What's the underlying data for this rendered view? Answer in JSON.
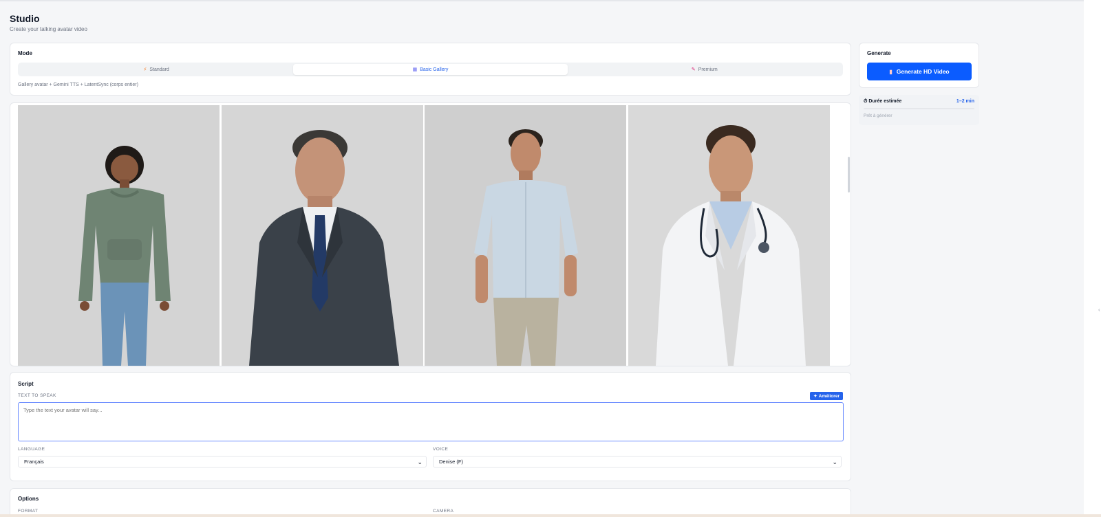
{
  "page": {
    "title": "Studio",
    "subtitle": "Create your talking avatar video"
  },
  "mode": {
    "title": "Mode",
    "options": [
      {
        "label": "Standard",
        "icon": "bolt-icon",
        "active": false
      },
      {
        "label": "Basic Gallery",
        "icon": "gallery-icon",
        "active": true
      },
      {
        "label": "Premium",
        "icon": "brush-icon",
        "active": false
      }
    ],
    "description": "Gallery avatar + Gemini TTS + LatentSync (corps entier)"
  },
  "generate": {
    "title": "Generate",
    "button_label": "Generate HD Video",
    "button_icon": "film-icon",
    "estimate_label": "Durée estimée",
    "estimate_value": "1–2 min",
    "status": "Prêt à générer",
    "accent_color": "#0b5cff"
  },
  "gallery": {
    "avatars": [
      {
        "name": "woman-green-hoodie"
      },
      {
        "name": "man-dark-suit"
      },
      {
        "name": "man-light-shirt"
      },
      {
        "name": "doctor-white-coat"
      }
    ]
  },
  "script": {
    "title": "Script",
    "text_label": "TEXT TO SPEAK",
    "improve_label": "Améliorer",
    "text_placeholder": "Type the text your avatar will say...",
    "language_label": "LANGUAGE",
    "language_value": "Français",
    "voice_label": "VOICE",
    "voice_value": "Denise (F)"
  },
  "options": {
    "title": "Options",
    "format_label": "FORMAT",
    "camera_label": "CAMERA"
  }
}
